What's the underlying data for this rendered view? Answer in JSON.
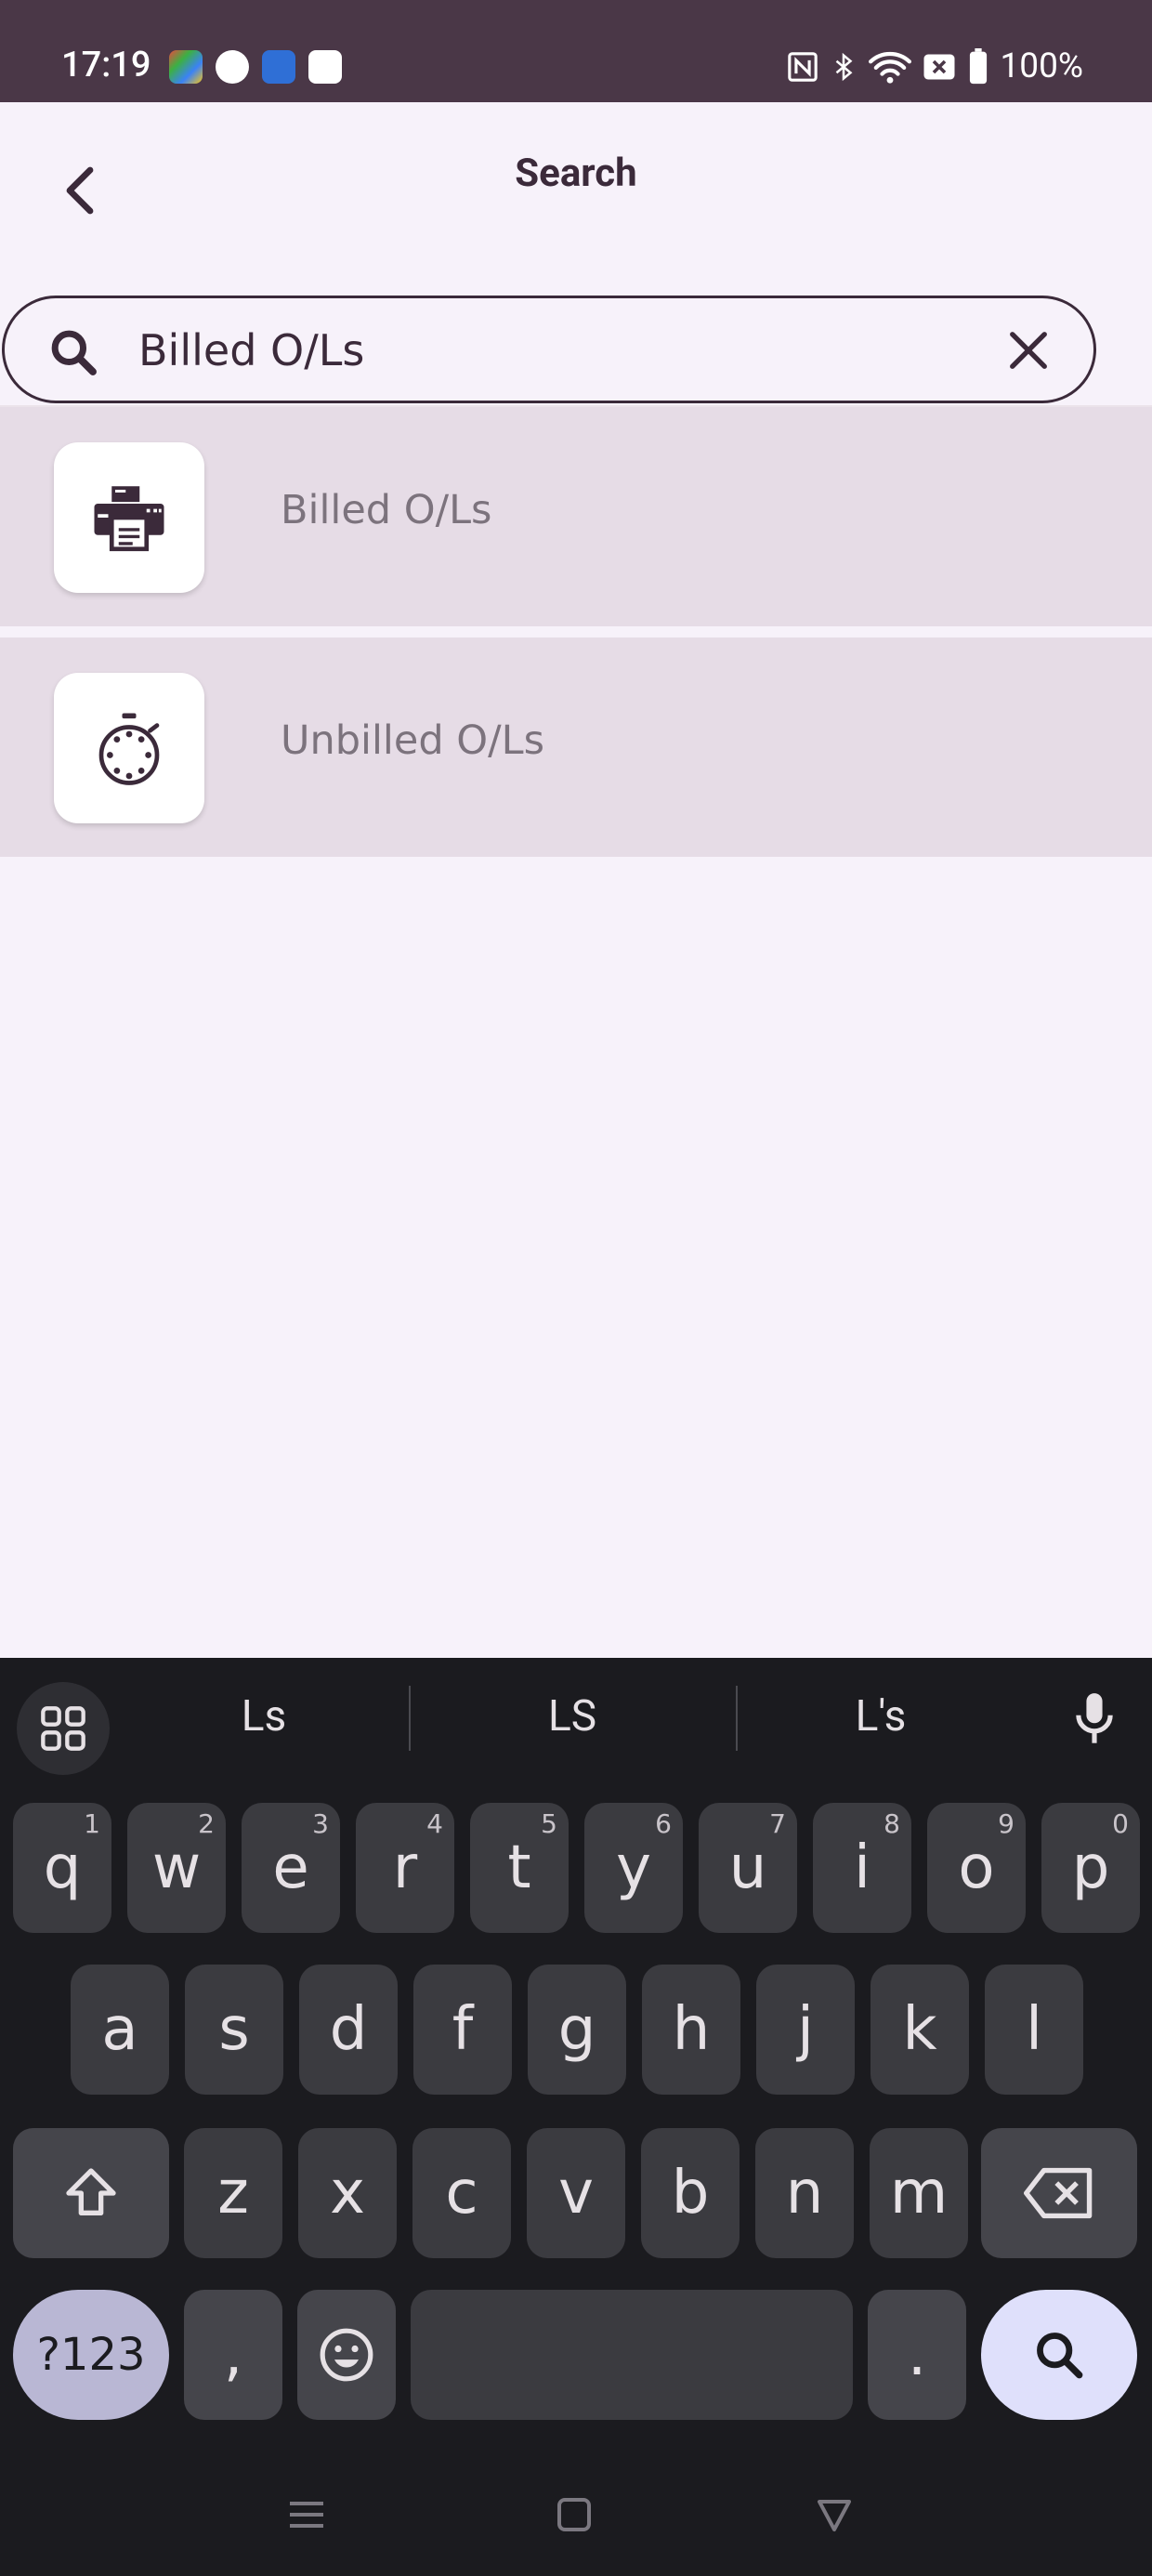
{
  "status_bar": {
    "time": "17:19",
    "battery": "100%",
    "icons": [
      "nfc-icon",
      "bluetooth-icon",
      "wifi-icon",
      "no-sim-icon",
      "battery-icon"
    ]
  },
  "header": {
    "title": "Search",
    "back_icon": "chevron-left-icon"
  },
  "search": {
    "value": "Billed O/Ls",
    "search_icon": "search-icon",
    "clear_icon": "close-icon"
  },
  "results": [
    {
      "label": "Billed O/Ls",
      "icon": "printer-icon"
    },
    {
      "label": "Unbilled O/Ls",
      "icon": "stopwatch-icon"
    }
  ],
  "keyboard": {
    "suggestions": [
      "Ls",
      "LS",
      "L's"
    ],
    "row1": [
      {
        "k": "q",
        "n": "1"
      },
      {
        "k": "w",
        "n": "2"
      },
      {
        "k": "e",
        "n": "3"
      },
      {
        "k": "r",
        "n": "4"
      },
      {
        "k": "t",
        "n": "5"
      },
      {
        "k": "y",
        "n": "6"
      },
      {
        "k": "u",
        "n": "7"
      },
      {
        "k": "i",
        "n": "8"
      },
      {
        "k": "o",
        "n": "9"
      },
      {
        "k": "p",
        "n": "0"
      }
    ],
    "row2": [
      "a",
      "s",
      "d",
      "f",
      "g",
      "h",
      "j",
      "k",
      "l"
    ],
    "row3": [
      "z",
      "x",
      "c",
      "v",
      "b",
      "n",
      "m"
    ],
    "symbols_label": "?123",
    "comma": ",",
    "period": "."
  },
  "colors": {
    "status_bar_bg": "#4a3747",
    "page_bg": "#f7f2fa",
    "row_bg": "#e6dce6",
    "accent_dark": "#3b2a3a",
    "keyboard_bg": "#1b1b1f"
  }
}
